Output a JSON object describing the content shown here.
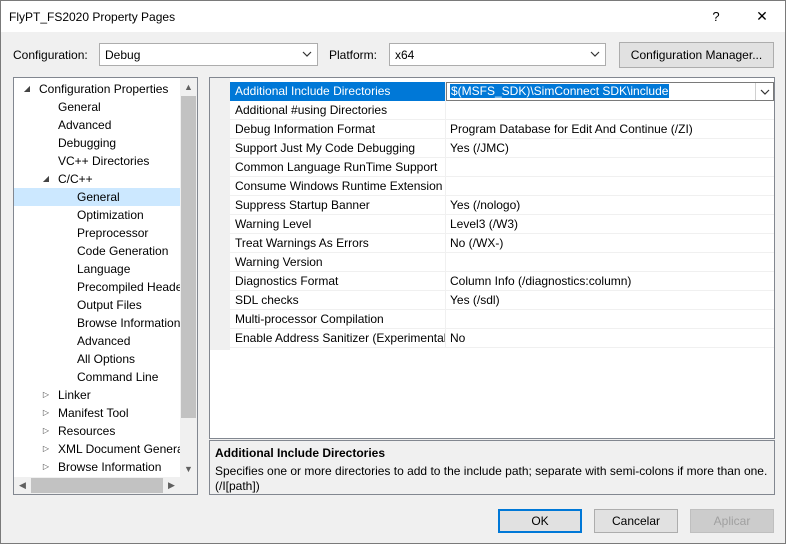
{
  "window": {
    "title": "FlyPT_FS2020 Property Pages",
    "help_glyph": "?",
    "close_glyph": "✕"
  },
  "toolbar": {
    "configuration_label": "Configuration:",
    "configuration_value": "Debug",
    "platform_label": "Platform:",
    "platform_value": "x64",
    "config_manager_label": "Configuration Manager..."
  },
  "tree": {
    "items": [
      {
        "label": "Configuration Properties",
        "toggle": "◢"
      },
      {
        "label": "General"
      },
      {
        "label": "Advanced"
      },
      {
        "label": "Debugging"
      },
      {
        "label": "VC++ Directories"
      },
      {
        "label": "C/C++",
        "toggle": "◢"
      },
      {
        "label": "General"
      },
      {
        "label": "Optimization"
      },
      {
        "label": "Preprocessor"
      },
      {
        "label": "Code Generation"
      },
      {
        "label": "Language"
      },
      {
        "label": "Precompiled Headers"
      },
      {
        "label": "Output Files"
      },
      {
        "label": "Browse Information"
      },
      {
        "label": "Advanced"
      },
      {
        "label": "All Options"
      },
      {
        "label": "Command Line"
      },
      {
        "label": "Linker",
        "toggle": "▷"
      },
      {
        "label": "Manifest Tool",
        "toggle": "▷"
      },
      {
        "label": "Resources",
        "toggle": "▷"
      },
      {
        "label": "XML Document Generator",
        "toggle": "▷"
      },
      {
        "label": "Browse Information",
        "toggle": "▷"
      }
    ],
    "selected_index": 6
  },
  "properties": {
    "rows": [
      {
        "name": "Additional Include Directories",
        "value": "$(MSFS_SDK)\\SimConnect SDK\\include"
      },
      {
        "name": "Additional #using Directories",
        "value": ""
      },
      {
        "name": "Debug Information Format",
        "value": "Program Database for Edit And Continue (/ZI)"
      },
      {
        "name": "Support Just My Code Debugging",
        "value": "Yes (/JMC)"
      },
      {
        "name": "Common Language RunTime Support",
        "value": ""
      },
      {
        "name": "Consume Windows Runtime Extension",
        "value": ""
      },
      {
        "name": "Suppress Startup Banner",
        "value": "Yes (/nologo)"
      },
      {
        "name": "Warning Level",
        "value": "Level3 (/W3)"
      },
      {
        "name": "Treat Warnings As Errors",
        "value": "No (/WX-)"
      },
      {
        "name": "Warning Version",
        "value": ""
      },
      {
        "name": "Diagnostics Format",
        "value": "Column Info (/diagnostics:column)"
      },
      {
        "name": "SDL checks",
        "value": "Yes (/sdl)"
      },
      {
        "name": "Multi-processor Compilation",
        "value": ""
      },
      {
        "name": "Enable Address Sanitizer (Experimental)",
        "value": "No"
      }
    ],
    "selected_index": 0
  },
  "description": {
    "title": "Additional Include Directories",
    "text": "Specifies one or more directories to add to the include path; separate with semi-colons if more than one.   (/I[path])"
  },
  "buttons": {
    "ok": "OK",
    "cancel": "Cancelar",
    "apply": "Aplicar"
  },
  "colors": {
    "accent": "#0078d7",
    "tree_selection": "#cce8ff"
  }
}
